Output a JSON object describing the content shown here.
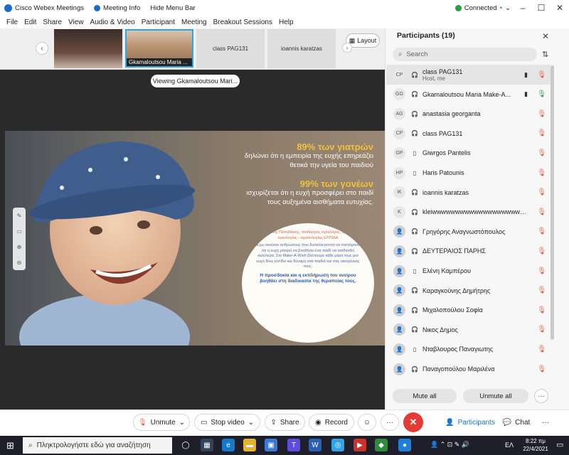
{
  "window": {
    "app_title": "Cisco Webex Meetings",
    "meeting_info": "Meeting Info",
    "hide_menu": "Hide Menu Bar",
    "status": "Connected"
  },
  "menu": [
    "File",
    "Edit",
    "Share",
    "View",
    "Audio & Video",
    "Participant",
    "Meeting",
    "Breakout Sessions",
    "Help"
  ],
  "thumbs": [
    {
      "label": ""
    },
    {
      "label": "Gkamaloutsou Maria ..."
    },
    {
      "label": "class PAG131"
    },
    {
      "label": "ioannis karatzas"
    }
  ],
  "layout_label": "Layout",
  "viewing": "Viewing Gkamaloutsou Mari...",
  "slide": {
    "head1": "89% των γιατρών",
    "line1a": "δηλώνει ότι η εμπειρία της ευχής επηρεάζει",
    "line1b": "θετικά την υγεία του παιδιού",
    "head2": "99% των γονέων",
    "line2a": "ισχυρίζεται ότι η ευχή προσφέρει στο παιδί",
    "line2b": "τους αυξημένα αισθήματα ευτυχίας.",
    "circle_top": "Βασίλης Παπαδάκης, παιδίατρος ογκολόγος, τμήμα ογκολογίας - αιματολογίας ΕΛΠΙΔΑ",
    "circle_body": "Έχω ακούσει ανθρώπους που δυσκολεύονται να πιστέψουν ότι η ευχή μπορεί να βοηθήσει ένα παιδί να αισθανθεί καλύτερα. Στο Make-A-Wish βλέπουμε κάθε μέρα πώς μια ευχή δίνει ελπίδα και δύναμη στα παιδιά και στις οικογένειές τους.",
    "circle_bold": "Η προσδοκία και η εκπλήρωση του ονείρου βοηθάει στη διαδικασία της θεραπείας τους."
  },
  "participants": {
    "title": "Participants (19)",
    "search_placeholder": "Search",
    "list": [
      {
        "initials": "CP",
        "name": "class PAG131",
        "sub": "Host, me",
        "device": "headset",
        "cam": true,
        "mic": "muted"
      },
      {
        "initials": "GG",
        "name": "Gkamaloutsou Maria Make-A...",
        "sub": "",
        "device": "headset",
        "cam": true,
        "mic": "on"
      },
      {
        "initials": "AG",
        "name": "anastasia georganta",
        "sub": "",
        "device": "headset",
        "cam": false,
        "mic": "muted"
      },
      {
        "initials": "CP",
        "name": "class PAG131",
        "sub": "",
        "device": "headset",
        "cam": false,
        "mic": "muted"
      },
      {
        "initials": "GP",
        "name": "Giwrgos Pantelis",
        "sub": "",
        "device": "phone",
        "cam": false,
        "mic": "muted"
      },
      {
        "initials": "HP",
        "name": "Haris Patounis",
        "sub": "",
        "device": "phone",
        "cam": false,
        "mic": "muted"
      },
      {
        "initials": "IK",
        "name": "ioannis karatzas",
        "sub": "",
        "device": "headset",
        "cam": false,
        "mic": "muted"
      },
      {
        "initials": "K",
        "name": "kleiwwwwwwwwwwwwwwwwwwwwwww...",
        "sub": "",
        "device": "headset",
        "cam": false,
        "mic": "muted"
      },
      {
        "initials": "",
        "name": "Γρηγόρης Αναγνωστόπουλος",
        "sub": "",
        "device": "headset",
        "cam": false,
        "mic": "muted"
      },
      {
        "initials": "",
        "name": "ΔΕΥΤΕΡΑΙΟΣ ΠΑΡΗΣ",
        "sub": "",
        "device": "headset",
        "cam": false,
        "mic": "muted"
      },
      {
        "initials": "",
        "name": "Ελένη Καμπέρου",
        "sub": "",
        "device": "phone",
        "cam": false,
        "mic": "muted"
      },
      {
        "initials": "",
        "name": "Καραγκούνης Δημήτρης",
        "sub": "",
        "device": "headset",
        "cam": false,
        "mic": "muted"
      },
      {
        "initials": "",
        "name": "Μιχαλοπούλου Σοφία",
        "sub": "",
        "device": "headset",
        "cam": false,
        "mic": "muted"
      },
      {
        "initials": "",
        "name": "Νικος Δημος",
        "sub": "",
        "device": "headset",
        "cam": false,
        "mic": "muted"
      },
      {
        "initials": "",
        "name": "Νταβλουρος Παναγιωτης",
        "sub": "",
        "device": "phone",
        "cam": false,
        "mic": "muted"
      },
      {
        "initials": "",
        "name": "Παναγοπούλου Μαριλένα",
        "sub": "",
        "device": "headset",
        "cam": false,
        "mic": "muted"
      }
    ],
    "mute_all": "Mute all",
    "unmute_all": "Unmute all"
  },
  "controls": {
    "unmute": "Unmute",
    "stop_video": "Stop video",
    "share": "Share",
    "record": "Record",
    "participants": "Participants",
    "chat": "Chat"
  },
  "taskbar": {
    "search_placeholder": "Πληκτρολογήστε εδώ για αναζήτηση",
    "lang": "ΕΛ",
    "time": "8:22 πμ",
    "date": "22/4/2021"
  },
  "colors": {
    "end_red": "#e43b35",
    "slide_gold": "#f0c23c",
    "mic_muted": "#e05a3a",
    "mic_on": "#25a045"
  }
}
